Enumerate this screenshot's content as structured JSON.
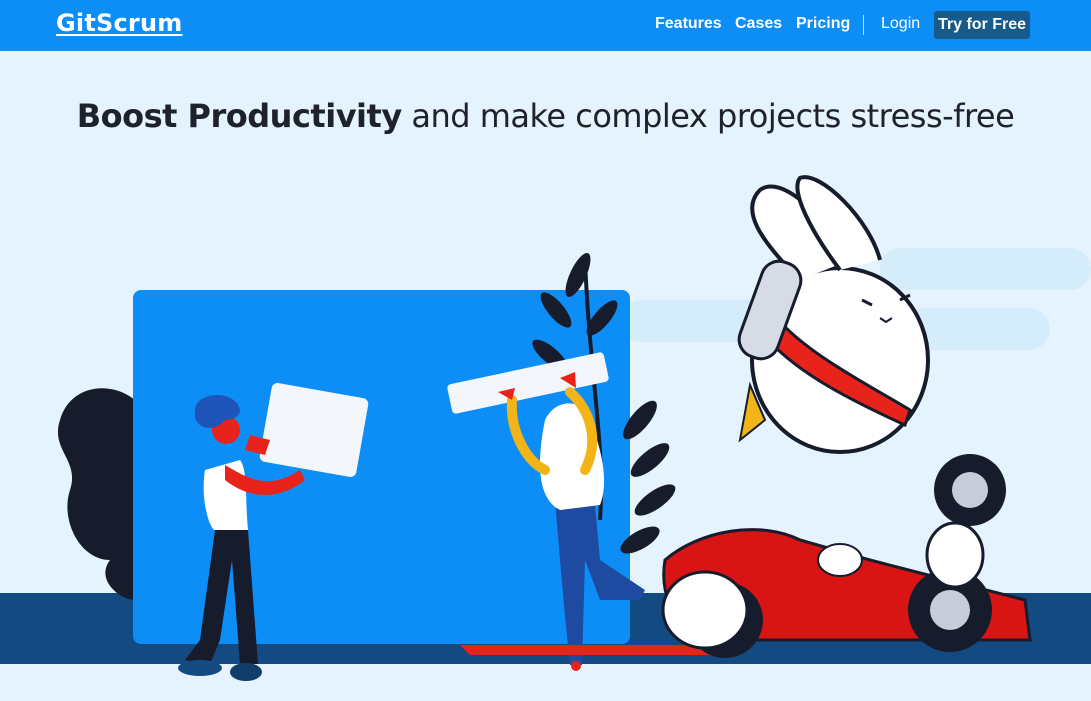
{
  "brand": {
    "logo_text": "GitScrum"
  },
  "nav": {
    "features": "Features",
    "cases": "Cases",
    "pricing": "Pricing",
    "login": "Login",
    "cta": "Try for Free"
  },
  "hero": {
    "headline_bold": "Boost Productivity",
    "headline_rest": " and make complex projects stress-free"
  },
  "colors": {
    "nav_bg": "#0d8ef7",
    "cta_bg": "#175b8c",
    "page_bg": "#e4f3fd",
    "board": "#0d8ef7",
    "floor": "#134a82",
    "car_red": "#d81414"
  }
}
